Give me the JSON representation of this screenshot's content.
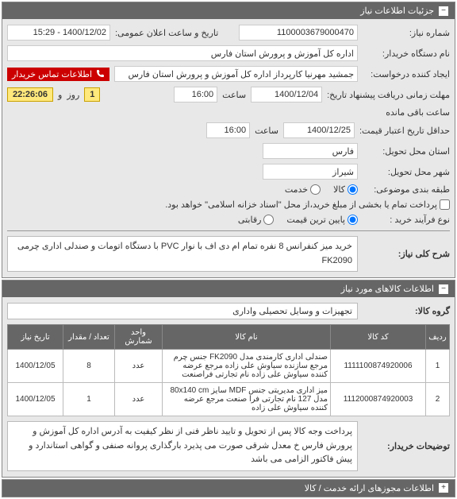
{
  "panel1": {
    "title": "جزئیات اطلاعات نیاز",
    "toggle": "−",
    "labels": {
      "req_no": "شماره نیاز:",
      "ann_date": "تاریخ و ساعت اعلان عمومی:",
      "buyer_org": "نام دستگاه خریدار:",
      "creator": "ایجاد کننده درخواست:",
      "contact": "اطلاعات تماس خریدار",
      "deadline": "مهلت زمانی دریافت پیشنهاد تاریخ:",
      "time": "ساعت",
      "and": "و",
      "day": "روز",
      "remain": "ساعت باقی مانده",
      "cred_deadline": "حداقل تاریخ اعتبار قیمت:",
      "province": "استان محل تحویل:",
      "city": "شهر محل تحویل:",
      "category": "طبقه بندی موضوعی:",
      "goods": "کالا",
      "service": "خدمت",
      "buy_type_lbl": "نوع فرآیند خرید :",
      "partial_pay": "پرداخت تمام یا بخشی از مبلغ خرید،از محل \"اسناد خزانه اسلامی\" خواهد بود.",
      "buy_type_low": "پایین ترین قیمت",
      "buy_type_comp": "رقابتی",
      "desc_lbl": "شرح کلی نیاز:"
    },
    "values": {
      "req_no": "1100003679000470",
      "ann_date": "1400/12/02 - 15:29",
      "buyer_org": "اداره کل آموزش و پرورش استان فارس",
      "creator": "جمشید مهرنیا کارپرداز اداره کل آموزش و پرورش استان فارس",
      "deadline_date": "1400/12/04",
      "deadline_time": "16:00",
      "countdown_days": "1",
      "countdown_time": "22:26:06",
      "cred_date": "1400/12/25",
      "cred_time": "16:00",
      "province": "فارس",
      "city": "شیراز",
      "desc": "خرید میز کنفرانس 8 نفره  تمام ام دی اف با نوار PVC با دستگاه اتومات و صندلی اداری چرمی FK2090"
    }
  },
  "panel2": {
    "title": "اطلاعات کالاهای مورد نیاز",
    "toggle": "−",
    "labels": {
      "group": "گروه کالا:",
      "buyer_notes": "توضیحات خریدار:"
    },
    "values": {
      "group": "تجهیزات و وسایل تحصیلی واداری",
      "buyer_notes": "پرداخت وجه کالا پس از تحویل و تایید ناظر فنی از نظر کیفیت به آدرس اداره کل آموزش و پرورش فارس خ معدل شرقی صورت می پذیرد بارگذاری پروانه صنفی و گواهی استاندارد و پیش فاکتور الزامی می باشد"
    },
    "table": {
      "headers": {
        "idx": "ردیف",
        "code": "کد کالا",
        "name": "نام کالا",
        "unit": "واحد شمارش",
        "qty": "تعداد / مقدار",
        "date": "تاریخ نیاز"
      },
      "rows": [
        {
          "idx": "1",
          "code": "1111100874920006",
          "name": "صندلی اداری کارمندی مدل FK2090 جنس چرم مرجع سازنده سیاوش علی زاده مرجع عرضه کننده سیاوش علی زاده نام تجارتی فراصنعت",
          "unit": "عدد",
          "qty": "8",
          "date": "1400/12/05"
        },
        {
          "idx": "2",
          "code": "1112000874920003",
          "name": "میز اداری مدیریتی جنس MDF سایز 80x140 cm مدل 127 نام تجارتی فرا صنعت مرجع عرضه کننده سیاوش علی زاده",
          "unit": "عدد",
          "qty": "1",
          "date": "1400/12/05"
        }
      ]
    }
  },
  "panel3": {
    "title": "اطلاعات مجوزهای ارائه خدمت / کالا",
    "toggle": "+"
  }
}
